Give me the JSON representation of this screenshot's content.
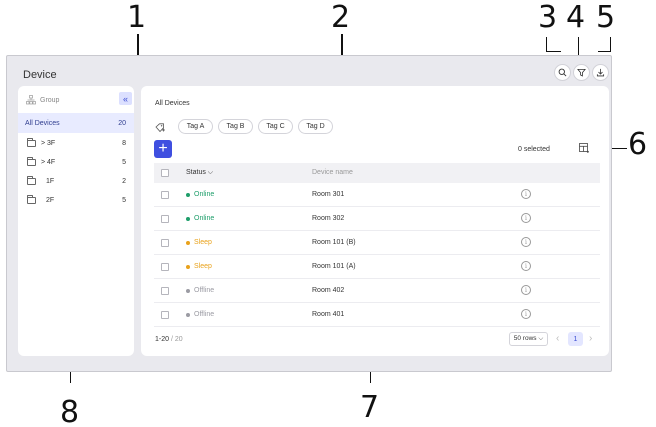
{
  "callouts": [
    "1",
    "2",
    "3",
    "4",
    "5",
    "6",
    "7",
    "8"
  ],
  "window": {
    "title": "Device"
  },
  "toolbar": {
    "icons": [
      "search-icon",
      "filter-icon",
      "download-icon"
    ]
  },
  "sidebar": {
    "group_label": "Group",
    "items": [
      {
        "label": "All Devices",
        "count": "20",
        "active": true
      },
      {
        "label": "> 3F",
        "count": "8"
      },
      {
        "label": "> 4F",
        "count": "5"
      },
      {
        "label": "1F",
        "count": "2"
      },
      {
        "label": "2F",
        "count": "5"
      }
    ]
  },
  "main": {
    "title": "All Devices",
    "tags": [
      "Tag A",
      "Tag B",
      "Tag C",
      "Tag D"
    ],
    "selected_text": "0 selected",
    "columns": {
      "status": "Status ⌵",
      "device": "Device name"
    },
    "rows": [
      {
        "status": "Online",
        "name": "Room 301"
      },
      {
        "status": "Online",
        "name": "Room 302"
      },
      {
        "status": "Sleep",
        "name": "Room 101 (B)"
      },
      {
        "status": "Sleep",
        "name": "Room 101 (A)"
      },
      {
        "status": "Offline",
        "name": "Room 402"
      },
      {
        "status": "Offline",
        "name": "Room 401"
      }
    ],
    "pager": {
      "range": "1-20",
      "total": "/ 20",
      "rows_per_page": "50 rows ⌵",
      "page": "1",
      "prev": "‹",
      "next": "›"
    }
  },
  "colors": {
    "accent": "#3f4fe0",
    "online": "#1e9e6a",
    "sleep": "#e9a21b",
    "offline": "#9b9ba3"
  }
}
